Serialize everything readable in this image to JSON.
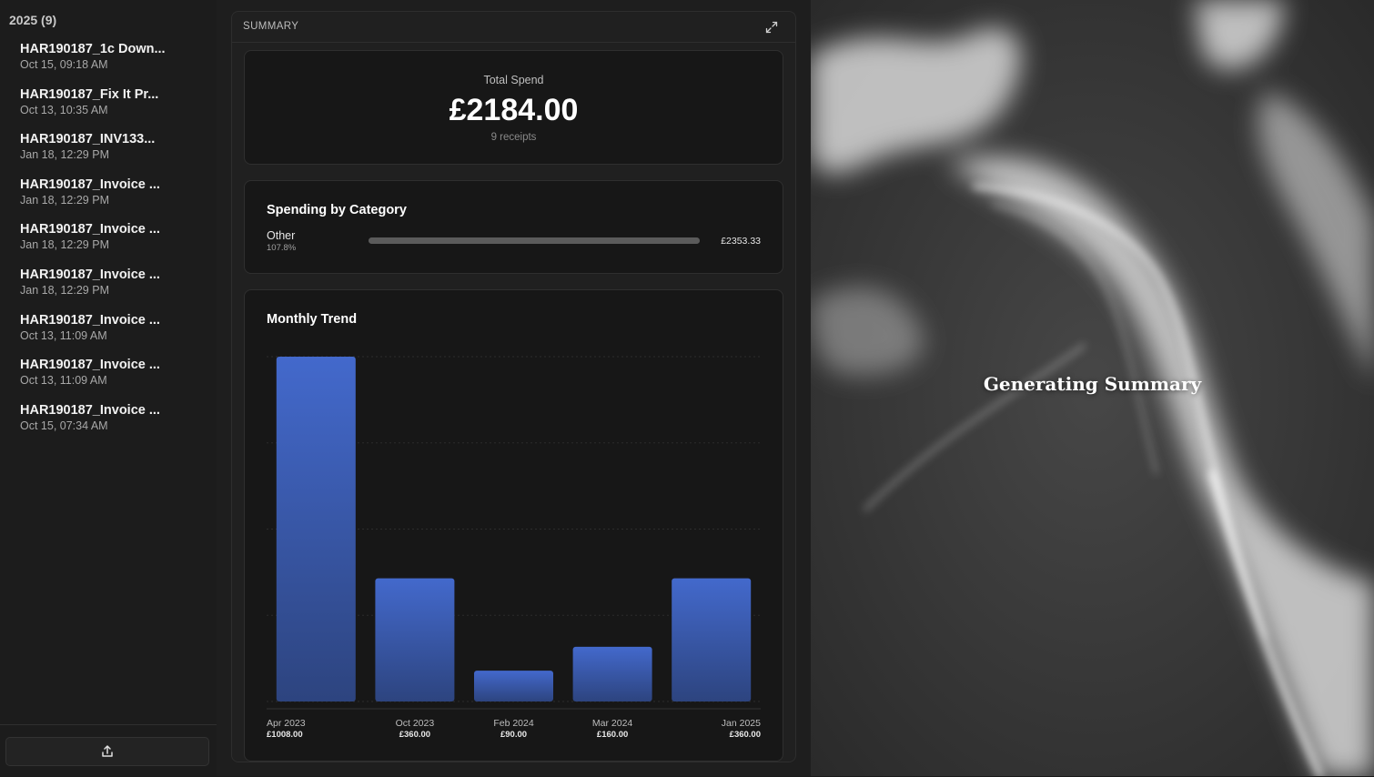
{
  "sidebar": {
    "year_header": "2025 (9)",
    "receipts": [
      {
        "name": "HAR190187_1c Down...",
        "date": "Oct 15, 09:18 AM"
      },
      {
        "name": "HAR190187_Fix It Pr...",
        "date": "Oct 13, 10:35 AM"
      },
      {
        "name": "HAR190187_INV133...",
        "date": "Jan 18, 12:29 PM"
      },
      {
        "name": "HAR190187_Invoice ...",
        "date": "Jan 18, 12:29 PM"
      },
      {
        "name": "HAR190187_Invoice ...",
        "date": "Jan 18, 12:29 PM"
      },
      {
        "name": "HAR190187_Invoice ...",
        "date": "Jan 18, 12:29 PM"
      },
      {
        "name": "HAR190187_Invoice ...",
        "date": "Oct 13, 11:09 AM"
      },
      {
        "name": "HAR190187_Invoice ...",
        "date": "Oct 13, 11:09 AM"
      },
      {
        "name": "HAR190187_Invoice ...",
        "date": "Oct 15, 07:34 AM"
      }
    ],
    "upload_icon": "upload-icon"
  },
  "summary": {
    "header": "SUMMARY",
    "expand_icon": "expand-icon",
    "total_label": "Total Spend",
    "total_value": "£2184.00",
    "receipts_count": "9 receipts"
  },
  "category": {
    "title": "Spending by Category",
    "items": [
      {
        "name": "Other",
        "percent": "107.8%",
        "amount": "£2353.33",
        "fill_fraction": 1.0
      }
    ]
  },
  "trend": {
    "title": "Monthly Trend"
  },
  "chart_data": {
    "type": "bar",
    "title": "Monthly Trend",
    "categories": [
      "Apr 2023",
      "Oct 2023",
      "Feb 2024",
      "Mar 2024",
      "Jan 2025"
    ],
    "values": [
      1008,
      360,
      90,
      160,
      360
    ],
    "value_labels": [
      "£1008.00",
      "£360.00",
      "£90.00",
      "£160.00",
      "£360.00"
    ],
    "ylim": [
      0,
      1008
    ],
    "grid": true,
    "bar_color": "#4166c6"
  },
  "right_panel": {
    "status": "Generating Summary"
  },
  "colors": {
    "background": "#1a1a1a",
    "card": "#171717",
    "accent_blue": "#4166c6"
  }
}
